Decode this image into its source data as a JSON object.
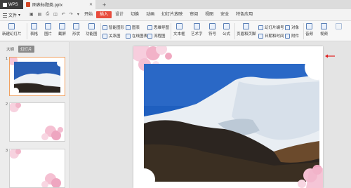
{
  "titlebar": {
    "app_label": "WPS",
    "doc_tab_label": "图表标题类.pptx",
    "new_tab_symbol": "+"
  },
  "menubar": {
    "file_label": "文件",
    "tabs": [
      {
        "label": "开始"
      },
      {
        "label": "插入"
      },
      {
        "label": "设计"
      },
      {
        "label": "切换"
      },
      {
        "label": "动画"
      },
      {
        "label": "幻灯片放映"
      },
      {
        "label": "审阅"
      },
      {
        "label": "视图"
      },
      {
        "label": "安全"
      },
      {
        "label": "特色应用"
      }
    ],
    "active_tab": "插入"
  },
  "ribbon": {
    "new_slide": "新建幻灯片",
    "table": "表格",
    "picture": "图片",
    "screenshot": "截屏",
    "shape": "形状",
    "feature_chart": "功能图",
    "smart_graphic": "智能图形",
    "relation_chart": "关系图",
    "chart": "图表",
    "online_chart": "在线图表",
    "mind_map": "思维导图",
    "flow_chart": "流程图",
    "textbox": "文本框",
    "art_text": "艺术字",
    "symbol": "符号",
    "formula": "公式",
    "header_footer": "页眉和页脚",
    "slide_number": "幻灯片编号",
    "date_time": "日期和时间",
    "object": "对象",
    "attachment": "附件",
    "audio": "音频",
    "video": "视频"
  },
  "leftpanel": {
    "view_outline": "大纲",
    "view_slides": "幻灯片",
    "slide_numbers": [
      "1",
      "2",
      "3"
    ]
  },
  "colors": {
    "accent": "#e84c3d",
    "selected_border": "#f0a060",
    "sky": "#1f5fbf"
  }
}
